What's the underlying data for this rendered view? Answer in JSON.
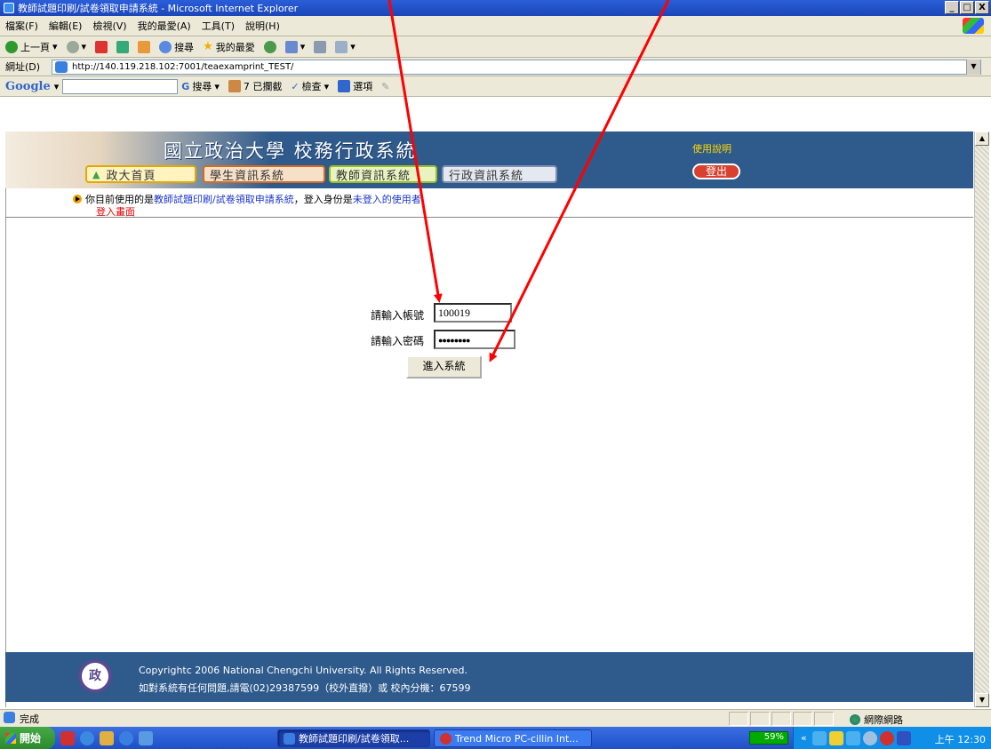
{
  "window": {
    "title": "教師試題印刷/試卷領取申請系統 - Microsoft Internet Explorer",
    "min": "_",
    "max": "□",
    "close": "X"
  },
  "menu": [
    "檔案(F)",
    "編輯(E)",
    "檢視(V)",
    "我的最愛(A)",
    "工具(T)",
    "說明(H)"
  ],
  "toolbar": {
    "back": "上一頁",
    "search": "搜尋",
    "favorites": "我的最愛"
  },
  "address": {
    "label": "網址(D)",
    "url": "http://140.119.218.102:7001/teaexamprint_TEST/"
  },
  "googlebar": {
    "logo": "Google",
    "search": "搜尋",
    "blocked": "7 已攔截",
    "check": "檢查",
    "options": "選項"
  },
  "banner": {
    "title": "國立政治大學 校務行政系統",
    "help": "使用說明",
    "logout": "登出",
    "nav": [
      "政大首頁",
      "學生資訊系統",
      "教師資訊系統",
      "行政資訊系統"
    ]
  },
  "status": {
    "prefix": "你目前使用的是",
    "system": "教師試題印刷/試卷領取申請系統",
    "middle": "，登入身份是",
    "identity": "未登入的使用者",
    "login_link": "登入畫面"
  },
  "login": {
    "account_label": "請輸入帳號",
    "account_value": "100019",
    "password_label": "請輸入密碼",
    "password_value": "●●●●●●●●",
    "submit": "進入系統"
  },
  "footer": {
    "logo_text": "政",
    "line1": "Copyrightc 2006 National Chengchi University. All Rights Reserved.",
    "line2": "如對系統有任何問題,請電(02)29387599（校外直撥）或 校內分機：67599"
  },
  "statusbar": {
    "done": "完成",
    "zone": "網際網路"
  },
  "taskbar": {
    "start": "開始",
    "task1": "教師試題印刷/試卷領取...",
    "task2": "Trend Micro PC-cillin Int...",
    "meter": "59%",
    "clock": "上午 12:30"
  },
  "colors": {
    "banner": "#2e5a8c",
    "arrow": "#ff0000"
  }
}
